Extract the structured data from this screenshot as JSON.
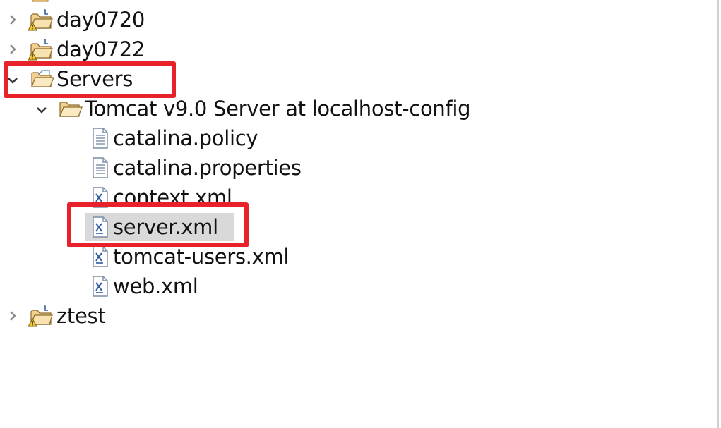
{
  "tree": {
    "items": [
      {
        "label": "day0720",
        "expanded": false,
        "icon": "project-warning-icon"
      },
      {
        "label": "day0722",
        "expanded": false,
        "icon": "project-warning-icon"
      },
      {
        "label": "Servers",
        "expanded": true,
        "icon": "folder-open-icon"
      },
      {
        "label": "Tomcat v9.0 Server at localhost-config",
        "expanded": true,
        "icon": "folder-open-icon"
      },
      {
        "label": "catalina.policy",
        "icon": "text-file-icon"
      },
      {
        "label": "catalina.properties",
        "icon": "text-file-icon"
      },
      {
        "label": "context.xml",
        "icon": "xml-file-icon"
      },
      {
        "label": "server.xml",
        "icon": "xml-file-icon",
        "selected": true
      },
      {
        "label": "tomcat-users.xml",
        "icon": "xml-file-icon"
      },
      {
        "label": "web.xml",
        "icon": "xml-file-icon"
      },
      {
        "label": "ztest",
        "expanded": false,
        "icon": "project-warning-icon"
      }
    ]
  },
  "colors": {
    "highlight": "#e8212b",
    "selection": "#d9d9d9",
    "folder": "#e8b86a",
    "file_blue": "#5a7fb5"
  }
}
